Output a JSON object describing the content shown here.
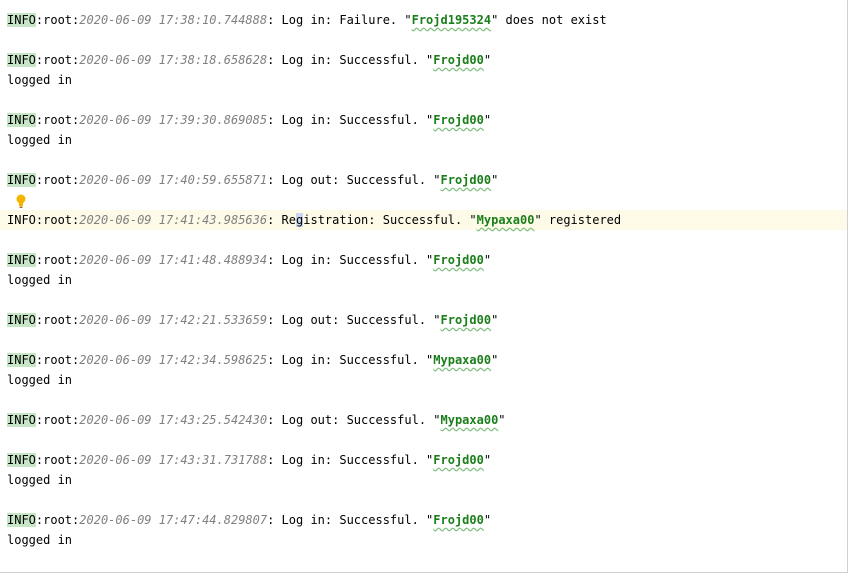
{
  "entries": [
    {
      "level": "INFO",
      "logger": ":root:",
      "ts": "2020-06-09 17:38:10.744888",
      "before": ": Log in: Failure. \"",
      "user": "Frojd195324",
      "after": "\" does not exist",
      "extra": ""
    },
    {
      "level": "INFO",
      "logger": ":root:",
      "ts": "2020-06-09 17:38:18.658628",
      "before": ": Log in: Successful. \"",
      "user": "Frojd00",
      "after": "\"",
      "extra": "logged in"
    },
    {
      "level": "INFO",
      "logger": ":root:",
      "ts": "2020-06-09 17:39:30.869085",
      "before": ": Log in: Successful. \"",
      "user": "Frojd00",
      "after": "\"",
      "extra": "logged in"
    },
    {
      "level": "INFO",
      "logger": ":root:",
      "ts": "2020-06-09 17:40:59.655871",
      "before": ": Log out: Successful. \"",
      "user": "Frojd00",
      "after": "\"",
      "extra": ""
    },
    {
      "level": "INFO",
      "logger": ":root:",
      "ts": "2020-06-09 17:41:43.985636",
      "before_a": ": Re",
      "caret": "g",
      "before_b": "istration: Successful. \"",
      "user": "Mypaxa00",
      "after": "\" registered",
      "extra": ""
    },
    {
      "level": "INFO",
      "logger": ":root:",
      "ts": "2020-06-09 17:41:48.488934",
      "before": ": Log in: Successful. \"",
      "user": "Frojd00",
      "after": "\"",
      "extra": "logged in"
    },
    {
      "level": "INFO",
      "logger": ":root:",
      "ts": "2020-06-09 17:42:21.533659",
      "before": ": Log out: Successful. \"",
      "user": "Frojd00",
      "after": "\"",
      "extra": ""
    },
    {
      "level": "INFO",
      "logger": ":root:",
      "ts": "2020-06-09 17:42:34.598625",
      "before": ": Log in: Successful. \"",
      "user": "Mypaxa00",
      "after": "\"",
      "extra": "logged in"
    },
    {
      "level": "INFO",
      "logger": ":root:",
      "ts": "2020-06-09 17:43:25.542430",
      "before": ": Log out: Successful. \"",
      "user": "Mypaxa00",
      "after": "\"",
      "extra": ""
    },
    {
      "level": "INFO",
      "logger": ":root:",
      "ts": "2020-06-09 17:43:31.731788",
      "before": ": Log in: Successful. \"",
      "user": "Frojd00",
      "after": "\"",
      "extra": "logged in"
    },
    {
      "level": "INFO",
      "logger": ":root:",
      "ts": "2020-06-09 17:47:44.829807",
      "before": ": Log in: Successful. \"",
      "user": "Frojd00",
      "after": "\"",
      "extra": "logged in"
    }
  ],
  "colors": {
    "level_bg": "#c6e6c7",
    "timestamp": "#808080",
    "username": "#1a7f1a",
    "current_line": "#fdfbe8"
  },
  "icons": {
    "gutter": "lightbulb-icon"
  }
}
